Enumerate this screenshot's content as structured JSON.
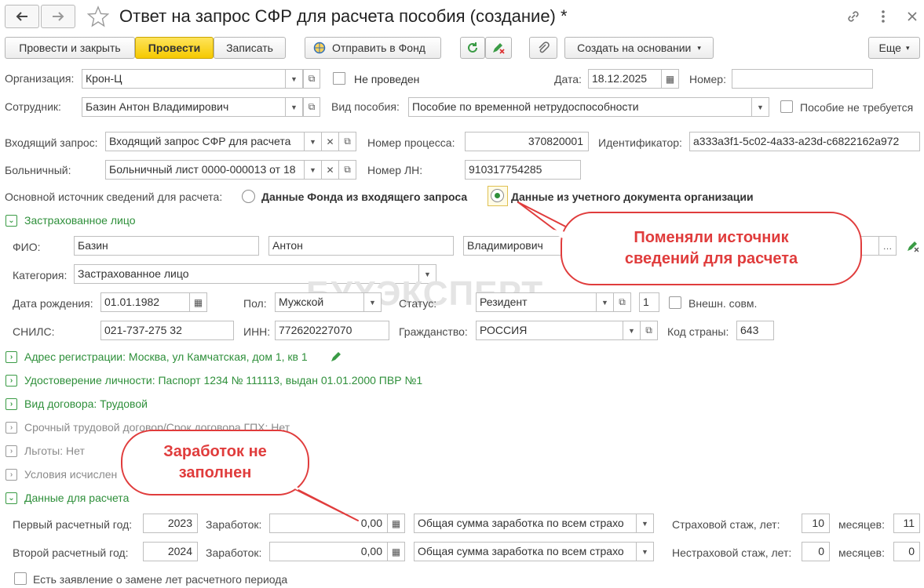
{
  "window": {
    "title": "Ответ на запрос СФР для расчета пособия (создание) *"
  },
  "toolbar": {
    "post_close": "Провести и закрыть",
    "post": "Провести",
    "save": "Записать",
    "send_fund": "Отправить в Фонд",
    "create_basis": "Создать на основании",
    "more": "Еще"
  },
  "header": {
    "org_label": "Организация:",
    "org_value": "Крон-Ц",
    "not_posted": "Не проведен",
    "date_label": "Дата:",
    "date_value": "18.12.2025",
    "number_label": "Номер:",
    "number_value": "",
    "employee_label": "Сотрудник:",
    "employee_value": "Базин Антон Владимирович",
    "benefit_label": "Вид пособия:",
    "benefit_value": "Пособие по временной нетрудоспособности",
    "benefit_not_required": "Пособие не требуется",
    "incoming_label": "Входящий запрос:",
    "incoming_value": "Входящий запрос СФР для расчета",
    "process_label": "Номер процесса:",
    "process_value": "370820001",
    "id_label": "Идентификатор:",
    "id_value": "a333a3f1-5c02-4a33-a23d-c6822162a972",
    "sick_label": "Больничный:",
    "sick_value": "Больничный лист 0000-000013 от 18",
    "ln_label": "Номер ЛН:",
    "ln_value": "910317754285",
    "source_label": "Основной источник сведений для расчета:",
    "source_option1": "Данные Фонда из входящего запроса",
    "source_option2": "Данные из учетного документа организации"
  },
  "insured": {
    "section_title": "Застрахованное лицо",
    "fio_label": "ФИО:",
    "last_name": "Базин",
    "first_name": "Антон",
    "middle_name": "Владимирович",
    "category_label": "Категория:",
    "category_value": "Застрахованное лицо",
    "birth_label": "Дата рождения:",
    "birth_value": "01.01.1982",
    "sex_label": "Пол:",
    "sex_value": "Мужской",
    "status_label": "Статус:",
    "status_value": "Резидент",
    "status_code": "1",
    "ext_label": "Внешн. совм.",
    "snils_label": "СНИЛС:",
    "snils_value": "021-737-275 32",
    "inn_label": "ИНН:",
    "inn_value": "772620227070",
    "citizenship_label": "Гражданство:",
    "citizenship_value": "РОССИЯ",
    "country_label": "Код страны:",
    "country_value": "643"
  },
  "sections": {
    "address": "Адрес регистрации: Москва, ул Камчатская, дом 1, кв 1",
    "identity": "Удостоверение личности: Паспорт 1234 № 111113, выдан 01.01.2000 ПВР №1",
    "contract": "Вид договора: Трудовой",
    "fixed_term": "Срочный трудовой договор/Срок договора ГПХ: Нет",
    "benefits": "Льготы: Нет",
    "conditions": "Условия исчислен",
    "calc_data": "Данные для расчета"
  },
  "calc": {
    "year1_label": "Первый расчетный год:",
    "year1_value": "2023",
    "year2_label": "Второй расчетный год:",
    "year2_value": "2024",
    "earnings_label": "Заработок:",
    "earnings1": "0,00",
    "earnings2": "0,00",
    "kind1": "Общая сумма заработка по всем страхо",
    "kind2": "Общая сумма заработка по всем страхо",
    "ins_label": "Страховой стаж, лет:",
    "ins_years": "10",
    "months_label": "месяцев:",
    "ins_months": "11",
    "nonins_label": "Нестраховой стаж, лет:",
    "nonins_years": "0",
    "nonins_months": "0",
    "replace_label": "Есть заявление о замене лет расчетного периода"
  },
  "annotations": {
    "bubble1_line1": "Поменяли источник",
    "bubble1_line2": "сведений для расчета",
    "bubble2_line1": "Заработок не",
    "bubble2_line2": "заполнен",
    "watermark": "БУХЭКСПЕРТ"
  },
  "colors": {
    "accent_green": "#2e8f3a",
    "annotation_red": "#e03c3c",
    "primary_yellow": "#f5c900"
  }
}
